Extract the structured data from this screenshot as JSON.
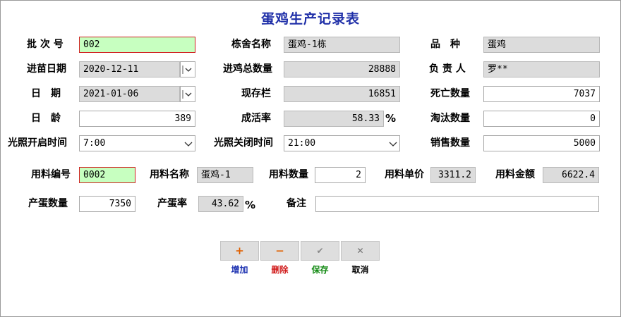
{
  "title": "蛋鸡生产记录表",
  "row1": {
    "batch_label": "批 次 号",
    "batch_value": "002",
    "house_label": "栋舍名称",
    "house_value": "蛋鸡-1栋",
    "breed_label": "品　种",
    "breed_value": "蛋鸡"
  },
  "row2": {
    "intake_date_label": "进苗日期",
    "intake_date_value": "2020-12-11",
    "total_label": "进鸡总数量",
    "total_value": "28888",
    "owner_label": "负 责 人",
    "owner_value": "罗**"
  },
  "row3": {
    "date_label": "日　期",
    "date_value": "2021-01-06",
    "stock_label": "现存栏",
    "stock_value": "16851",
    "death_label": "死亡数量",
    "death_value": "7037"
  },
  "row4": {
    "age_label": "日　龄",
    "age_value": "389",
    "survival_label": "成活率",
    "survival_value": "58.33",
    "survival_unit": "%",
    "cull_label": "淘汰数量",
    "cull_value": "0"
  },
  "row5": {
    "light_on_label": "光照开启时间",
    "light_on_value": "7:00",
    "light_off_label": "光照关闭时间",
    "light_off_value": "21:00",
    "sales_label": "销售数量",
    "sales_value": "5000"
  },
  "feed": {
    "code_label": "用料编号",
    "code_value": "0002",
    "name_label": "用料名称",
    "name_value": "蛋鸡-1",
    "qty_label": "用料数量",
    "qty_value": "2",
    "price_label": "用料单价",
    "price_value": "3311.2",
    "amount_label": "用料金额",
    "amount_value": "6622.4"
  },
  "eggs": {
    "count_label": "产蛋数量",
    "count_value": "7350",
    "rate_label": "产蛋率",
    "rate_value": "43.62",
    "rate_unit": "%",
    "remark_label": "备注",
    "remark_value": ""
  },
  "buttons": {
    "add_glyph": "+",
    "add_label": "增加",
    "delete_glyph": "−",
    "delete_label": "删除",
    "save_glyph": "✔",
    "save_label": "保存",
    "cancel_glyph": "✕",
    "cancel_label": "取消"
  },
  "colors": {
    "title": "#1f2fa8",
    "add": "#1a2fb0",
    "delete": "#d01818",
    "save": "#138a13",
    "cancel": "#000000",
    "add_icon": "#e06000",
    "delete_icon": "#e06000",
    "save_icon": "#8a8a8a",
    "cancel_icon": "#707070",
    "key_field_bg": "#c7ffc0",
    "key_field_border": "#d02020",
    "readonly_bg": "#dcdcdc"
  },
  "icons": {
    "dropdown": "chevron-down-icon",
    "date_spinner": "spinner-icon"
  }
}
